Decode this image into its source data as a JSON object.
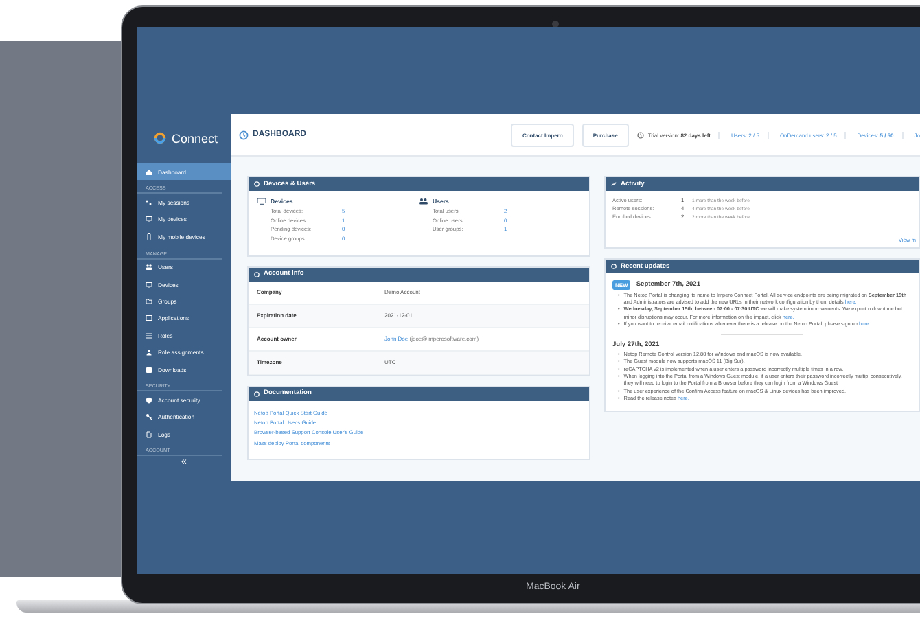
{
  "laptop": {
    "model_label": "MacBook Air"
  },
  "sidebar": {
    "logo": "Connect",
    "collapse": "«",
    "sections": [
      {
        "items": [
          {
            "label": "Dashboard",
            "selected": true
          }
        ]
      },
      {
        "heading": "ACCESS",
        "items": [
          {
            "label": "My sessions",
            "selected": false
          },
          {
            "label": "My devices",
            "selected": false
          },
          {
            "label": "My mobile devices",
            "selected": false
          }
        ]
      },
      {
        "heading": "MANAGE",
        "items": [
          {
            "label": "Users",
            "selected": false
          },
          {
            "label": "Devices",
            "selected": false
          },
          {
            "label": "Groups",
            "selected": false
          },
          {
            "label": "Applications",
            "selected": false
          },
          {
            "label": "Roles",
            "selected": false
          },
          {
            "label": "Role assignments",
            "selected": false
          },
          {
            "label": "Downloads",
            "selected": false
          }
        ]
      },
      {
        "heading": "SECURITY",
        "items": [
          {
            "label": "Account security",
            "selected": false
          },
          {
            "label": "Authentication",
            "selected": false
          },
          {
            "label": "Logs",
            "selected": false
          }
        ]
      },
      {
        "heading": "ACCOUNT"
      }
    ]
  },
  "topbar": {
    "title": "DASHBOARD",
    "buttons": [
      "Contact Impero",
      "Purchase"
    ],
    "trial": "Trial version: **82 days left**",
    "stats": [
      "Users: 2 / 5",
      "OnDemand users: 2 / 5",
      "Devices: **5 / 50**",
      "Jo"
    ]
  },
  "devices_users": {
    "title": "Devices & Users",
    "groups": [
      {
        "title": "Devices",
        "rows": [
          {
            "label": "Total devices:",
            "value": "5"
          },
          {
            "label": "Online devices:",
            "value": "1"
          },
          {
            "label": "Pending devices:",
            "value": "0"
          },
          {
            "label": "Device groups:",
            "value": "0"
          }
        ]
      },
      {
        "title": "Users",
        "rows": [
          {
            "label": "Total users:",
            "value": "2"
          },
          {
            "label": "Online users:",
            "value": "0"
          },
          {
            "label": "User groups:",
            "value": "1"
          }
        ]
      }
    ]
  },
  "account_info": {
    "title": "Account info",
    "rows": [
      {
        "label": "Company",
        "value": "Demo Account"
      },
      {
        "label": "Expiration date",
        "value": "2021-12-01"
      },
      {
        "label": "Account owner",
        "link": "John Doe",
        "value": "(jdoe@imperosoftware.com)"
      },
      {
        "label": "Timezone",
        "value": "UTC"
      }
    ]
  },
  "documentation": {
    "title": "Documentation",
    "links": [
      "Netop Portal Quick Start Guide",
      "Netop Portal User's Guide",
      "Browser-based Support Console User's Guide",
      "Mass deploy Portal components"
    ]
  },
  "activity": {
    "title": "Activity",
    "rows": [
      {
        "label": "Active users:",
        "value": "1",
        "note": "1 more than the week before"
      },
      {
        "label": "Remote sessions:",
        "value": "4",
        "note": "4 more than the week before"
      },
      {
        "label": "Enrolled devices:",
        "value": "2",
        "note": "2 more than the week before"
      }
    ],
    "more_link": "View m"
  },
  "recent_updates": {
    "title": "Recent updates",
    "entries": [
      {
        "badge": "NEW",
        "date": "September 7th, 2021",
        "bullets": [
          {
            "marker": "•",
            "text": "The Netop Portal is changing its name to Impero Connect Portal. All service endpoints are being migrated on **September 15th** and Administrators are advised to add the new URLs in their network configuration by then. details",
            "link": "here."
          },
          {
            "marker": "•",
            "text": "**Wednesday, September 15th, between 07:00 - 07:30 UTC** we will make system improvements. We expect n downtime but minor disruptions may occur. For more information on the impact, click",
            "link": "here."
          },
          {
            "marker": "•",
            "text": "If you want to receive email notifications whenever there is a release on the Netop Portal, please sign up",
            "link": "here."
          }
        ]
      },
      {
        "date": "July 27th, 2021",
        "bullets": [
          {
            "marker": "•",
            "text": "Netop Remote Control version 12.80 for Windows and macOS is now available."
          },
          {
            "marker": "•",
            "text": "The Guest module now supports macOS 11 (Big Sur)."
          },
          {
            "marker": "•",
            "text": "reCAPTCHA v2 is implemented when a user enters a password incorrectly multiple times in a row."
          },
          {
            "marker": "•",
            "text": "When logging into the Portal from a Windows Guest module, if a user enters their password incorrectly multipl consecutively, they will need to login to the Portal from a Browser before they can login from a Windows Guest"
          },
          {
            "marker": "•",
            "text": "The user experience of the Confirm Access feature on macOS & Linux devices has been improved."
          },
          {
            "marker": "•",
            "text": "Read the release notes",
            "link": "here."
          }
        ]
      }
    ]
  }
}
